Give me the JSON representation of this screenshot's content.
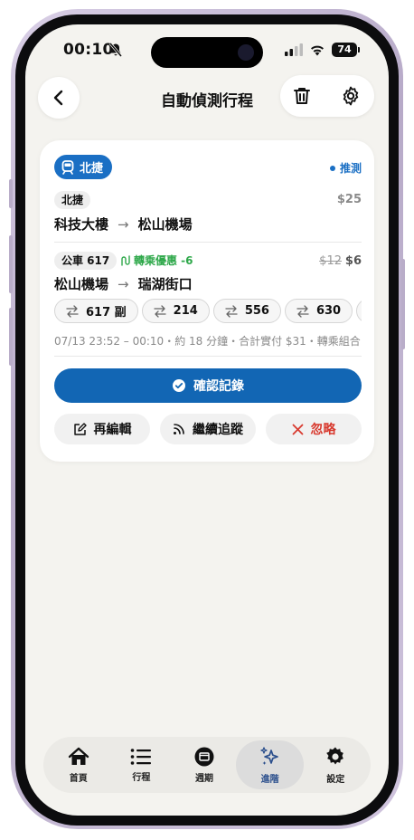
{
  "status_bar": {
    "time": "00:10",
    "battery": "74"
  },
  "header": {
    "title": "自動偵測行程"
  },
  "card": {
    "mode_badge": "北捷",
    "inferred_label": "推測",
    "legs": [
      {
        "chip": "北捷",
        "price": "$25",
        "from": "科技大樓",
        "to": "松山機場"
      },
      {
        "chip": "公車 617",
        "transfer": "轉乘優惠 -6",
        "price_old": "$12",
        "price": "$6",
        "from": "松山機場",
        "to": "瑞湖街口"
      }
    ],
    "alternatives": [
      "617 副",
      "214",
      "556",
      "630",
      ""
    ],
    "meta": "07/13 23:52 – 00:10・約 18 分鐘・合計實付 $31・轉乘組合",
    "confirm_label": "確認記錄",
    "edit_label": "再編輯",
    "track_label": "繼續追蹤",
    "ignore_label": "忽略"
  },
  "tabbar": {
    "items": [
      {
        "label": "首頁",
        "icon": "home-icon"
      },
      {
        "label": "行程",
        "icon": "list-icon"
      },
      {
        "label": "週期",
        "icon": "calendar-icon"
      },
      {
        "label": "進階",
        "icon": "sparkle-icon"
      },
      {
        "label": "設定",
        "icon": "gear-icon"
      }
    ],
    "active": "進階"
  },
  "colors": {
    "accent": "#1266b4",
    "transfer": "#2ea84a",
    "danger": "#d83a2f"
  }
}
